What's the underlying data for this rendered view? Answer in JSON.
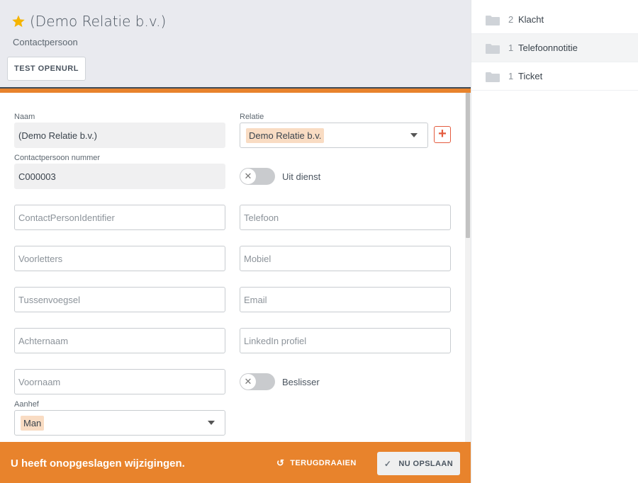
{
  "header": {
    "title": "(Demo Relatie b.v.)",
    "subtitle": "Contactpersoon",
    "test_button": "TEST OPENURL"
  },
  "form": {
    "naam": {
      "label": "Naam",
      "value": "(Demo Relatie b.v.)"
    },
    "relatie": {
      "label": "Relatie",
      "value": "Demo Relatie b.v."
    },
    "nummer": {
      "label": "Contactpersoon nummer",
      "value": "C000003"
    },
    "uit_dienst": {
      "label": "Uit dienst",
      "on": false
    },
    "identifier": {
      "placeholder": "ContactPersonIdentifier"
    },
    "telefoon": {
      "placeholder": "Telefoon"
    },
    "voorletters": {
      "placeholder": "Voorletters"
    },
    "mobiel": {
      "placeholder": "Mobiel"
    },
    "tussenvoegsel": {
      "placeholder": "Tussenvoegsel"
    },
    "email": {
      "placeholder": "Email"
    },
    "achternaam": {
      "placeholder": "Achternaam"
    },
    "linkedin": {
      "placeholder": "LinkedIn profiel"
    },
    "voornaam": {
      "placeholder": "Voornaam"
    },
    "beslisser": {
      "label": "Beslisser",
      "on": false
    },
    "aanhef": {
      "label": "Aanhef",
      "value": "Man"
    }
  },
  "footer": {
    "message": "U heeft onopgeslagen wijzigingen.",
    "revert": "TERUGDRAAIEN",
    "save": "NU OPSLAAN"
  },
  "sidebar": {
    "items": [
      {
        "count": "2",
        "label": "Klacht"
      },
      {
        "count": "1",
        "label": "Telefoonnotitie"
      },
      {
        "count": "1",
        "label": "Ticket"
      }
    ]
  },
  "colors": {
    "accent": "#e8832c",
    "star": "#f5b400",
    "tag": "#f9dcc3"
  }
}
